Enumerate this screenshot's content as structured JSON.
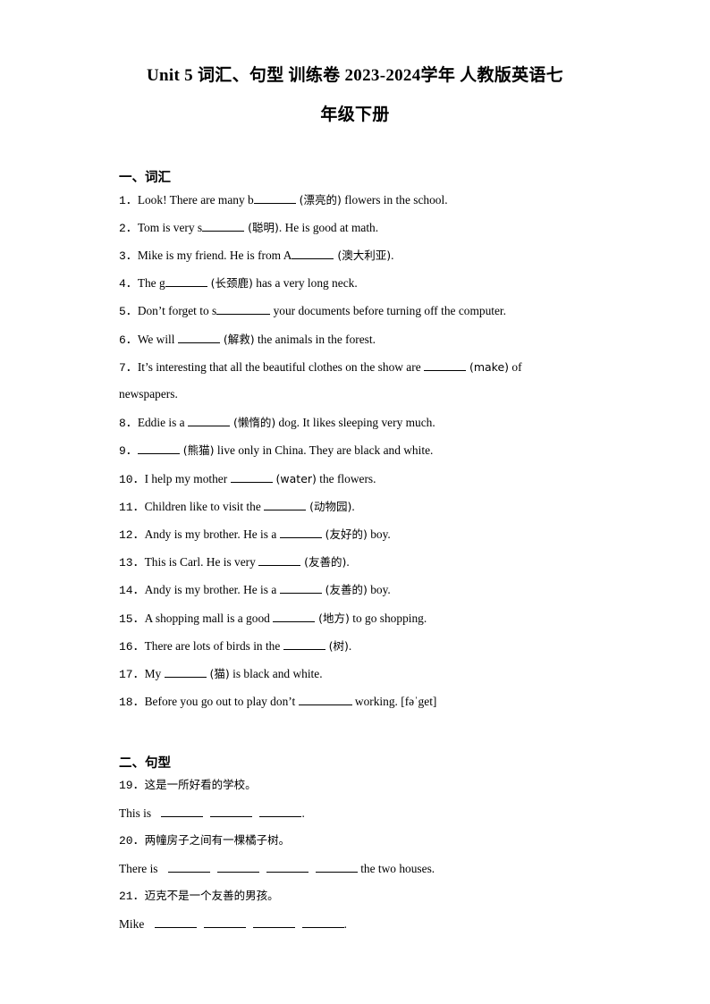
{
  "document": {
    "title_line1": "Unit 5 词汇、句型 训练卷 2023-2024学年 人教版英语七",
    "title_line2": "年级下册"
  },
  "sections": {
    "vocab_heading": "一、词汇",
    "sentence_heading": "二、句型"
  },
  "vocab": [
    {
      "num": "1．",
      "pre": "Look! There are many b",
      "hint": " (漂亮的)",
      "post": " flowers in the school."
    },
    {
      "num": "2．",
      "pre": "Tom is very s",
      "hint": " (聪明)",
      "post": ". He is good at math."
    },
    {
      "num": "3．",
      "pre": "Mike is my friend. He is from A",
      "hint": " (澳大利亚)",
      "post": "."
    },
    {
      "num": "4．",
      "pre": "The g",
      "hint": " (长颈鹿)",
      "post": " has a very long neck."
    },
    {
      "num": "5．",
      "pre": "Don’t forget to s",
      "hint": "",
      "post": " your documents before turning off the computer."
    },
    {
      "num": "6．",
      "pre": "We will ",
      "hint": " (解救)",
      "post": " the animals in the forest."
    },
    {
      "num": "7．",
      "pre": "It’s interesting that all the beautiful clothes on the show are ",
      "hint": " (make)",
      "post": " of",
      "cont": "newspapers."
    },
    {
      "num": "8．",
      "pre": "Eddie is a ",
      "hint": " (懒惰的)",
      "post": " dog. It likes sleeping very much."
    },
    {
      "num": "9．",
      "pre": "",
      "hint": " (熊猫)",
      "post": " live only in China. They are black and white."
    },
    {
      "num": "10．",
      "pre": "I help my mother ",
      "hint": " (water)",
      "post": " the flowers."
    },
    {
      "num": "11．",
      "pre": "Children like to visit the ",
      "hint": " (动物园)",
      "post": "."
    },
    {
      "num": "12．",
      "pre": "Andy is my brother. He is a ",
      "hint": " (友好的)",
      "post": " boy."
    },
    {
      "num": "13．",
      "pre": "This is Carl. He is very ",
      "hint": " (友善的)",
      "post": "."
    },
    {
      "num": "14．",
      "pre": "Andy is my brother. He is a ",
      "hint": " (友善的)",
      "post": " boy."
    },
    {
      "num": "15．",
      "pre": "A shopping mall is a good ",
      "hint": " (地方)",
      "post": " to go shopping."
    },
    {
      "num": "16．",
      "pre": "There are lots of birds in the ",
      "hint": " (树)",
      "post": "."
    },
    {
      "num": "17．",
      "pre": "My ",
      "hint": " (猫)",
      "post": " is black and white."
    },
    {
      "num": "18．",
      "pre": "Before you go out to play don’t ",
      "hint": "",
      "post": " working. [fəˈget]"
    }
  ],
  "sentences": [
    {
      "num": "19．",
      "prompt": "这是一所好看的学校。",
      "lead": "This is ",
      "tail": "."
    },
    {
      "num": "20．",
      "prompt": "两幢房子之间有一棵橘子树。",
      "lead": "There is ",
      "tail": " the two houses."
    },
    {
      "num": "21．",
      "prompt": "迈克不是一个友善的男孩。",
      "lead": "Mike ",
      "tail": "."
    }
  ]
}
